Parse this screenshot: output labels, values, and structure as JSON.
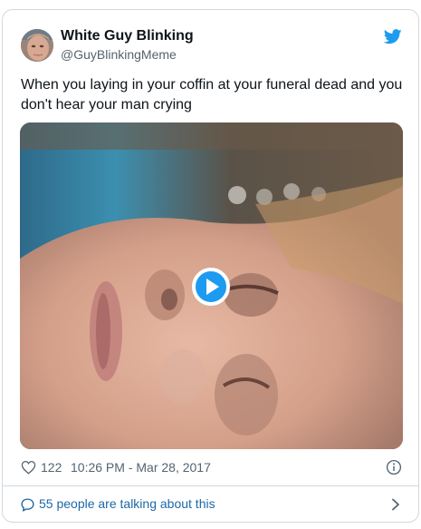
{
  "author": {
    "name": "White Guy Blinking",
    "handle": "@GuyBlinkingMeme",
    "avatar_icon": "avatar-face-icon"
  },
  "brand": {
    "icon": "twitter-bird-icon",
    "color": "#1d9bf0"
  },
  "tweet": {
    "text": "When you laying in your coffin at your funeral dead and you don't hear your man crying"
  },
  "media": {
    "type": "video",
    "play_icon": "play-icon",
    "accent_color": "#1d9bf0"
  },
  "meta": {
    "like_count": "122",
    "timestamp": "10:26 PM - Mar 28, 2017",
    "like_icon": "heart-icon",
    "info_icon": "info-icon"
  },
  "footer": {
    "label": "55 people are talking about this",
    "icon": "speech-bubble-icon",
    "chevron": "chevron-right-icon",
    "color": "#1d68a7"
  }
}
